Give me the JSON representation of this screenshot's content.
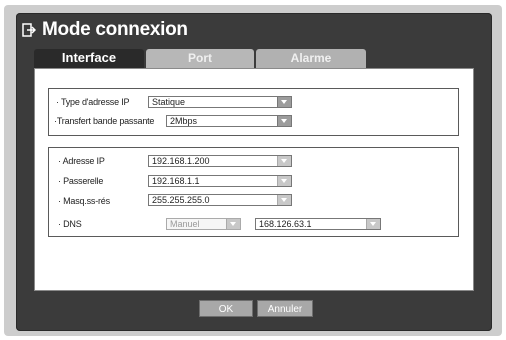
{
  "window": {
    "title": "Mode connexion",
    "title_icon": "exit-icon"
  },
  "tabs": [
    {
      "label": "Interface",
      "active": true
    },
    {
      "label": "Port",
      "active": false
    },
    {
      "label": "Alarme",
      "active": false
    }
  ],
  "group1": {
    "ip_type_label": "Type d'adresse IP",
    "ip_type_value": "Statique",
    "bandwidth_label": "Transfert bande passante",
    "bandwidth_value": "2Mbps"
  },
  "group2": {
    "ip_label": "Adresse IP",
    "ip_value": "192.168.1.200",
    "gateway_label": "Passerelle",
    "gateway_value": "192.168.1.1",
    "mask_label": "Masq.ss-rés",
    "mask_value": "255.255.255.0",
    "dns_label": "DNS",
    "dns_mode_value": "Manuel",
    "dns_value": "168.126.63.1"
  },
  "buttons": {
    "ok": "OK",
    "cancel": "Annuler"
  }
}
